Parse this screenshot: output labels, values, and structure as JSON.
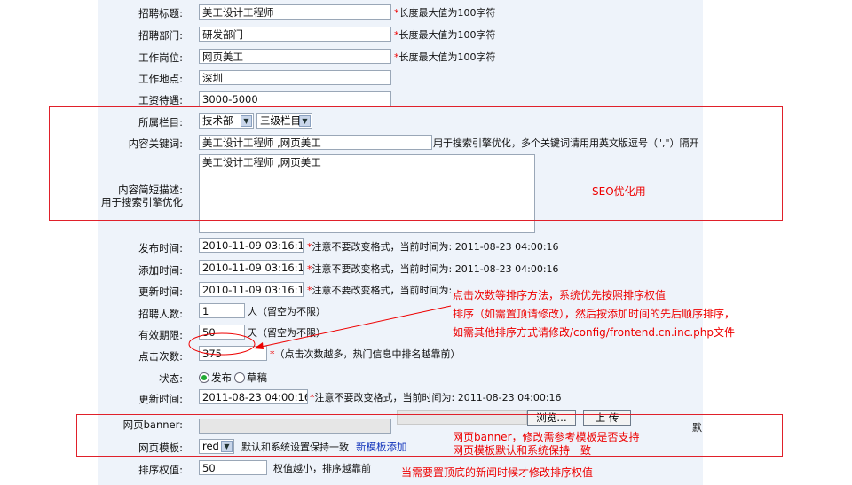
{
  "fields": {
    "title": {
      "label": "招聘标题:",
      "value": "美工设计工程师",
      "note": "长度最大值为100字符"
    },
    "dept": {
      "label": "招聘部门:",
      "value": "研发部门",
      "note": "长度最大值为100字符"
    },
    "position": {
      "label": "工作岗位:",
      "value": "网页美工",
      "note": "长度最大值为100字符"
    },
    "location": {
      "label": "工作地点:",
      "value": "深圳"
    },
    "salary": {
      "label": "工资待遇:",
      "value": "3000-5000"
    },
    "column": {
      "label": "所属栏目:",
      "select1": "技术部",
      "select2": "三级栏目"
    },
    "keywords": {
      "label": "内容关键词:",
      "value": "美工设计工程师 ,网页美工",
      "note": "用于搜索引擎优化，多个关键词请用用英文版逗号（\",\"）隔开"
    },
    "description": {
      "label1": "内容简短描述:",
      "label2": "用于搜索引擎优化",
      "value": "美工设计工程师 ,网页美工"
    },
    "publish_time": {
      "label": "发布时间:",
      "value": "2010-11-09 03:16:17",
      "note": "注意不要改变格式，当前时间为: 2011-08-23 04:00:16"
    },
    "add_time": {
      "label": "添加时间:",
      "value": "2010-11-09 03:16:17",
      "note": "注意不要改变格式，当前时间为: 2011-08-23 04:00:16"
    },
    "update_time": {
      "label": "更新时间:",
      "value": "2010-11-09 03:16:17",
      "note": "注意不要改变格式，当前时间为: 2011-08-23 04:00:16"
    },
    "headcount": {
      "label": "招聘人数:",
      "value": "1",
      "note": "人（留空为不限）"
    },
    "valid_period": {
      "label": "有效期限:",
      "value": "50",
      "note": "天（留空为不限）"
    },
    "clicks": {
      "label": "点击次数:",
      "value": "375",
      "note": "（点击次数越多，热门信息中排名越靠前）"
    },
    "status": {
      "label": "状态:",
      "opt1": "发布",
      "opt2": "草稿"
    },
    "update_time2": {
      "label": "更新时间:",
      "value": "2011-08-23 04:00:16",
      "note": "注意不要改变格式，当前时间为: 2011-08-23 04:00:16"
    },
    "banner": {
      "label": "网页banner:",
      "browse": "浏览…",
      "upload": "上 传",
      "extra": "默"
    },
    "template": {
      "label": "网页模板:",
      "value": "red",
      "note": "默认和系统设置保持一致",
      "link": "新模板添加"
    },
    "sort": {
      "label": "排序权值:",
      "value": "50",
      "note": "权值越小，排序越靠前"
    }
  },
  "annotations": {
    "seo": "SEO优化用",
    "clicks_line1": "点击次数等排序方法，系统优先按照排序权值",
    "clicks_line2": "排序（如需置顶请修改），然后按添加时间的先后顺序排序，",
    "clicks_line3": "如需其他排序方式请修改/config/frontend.cn.inc.php文件",
    "banner_line1": "网页banner，修改需参考模板是否支持",
    "banner_line2": "网页模板默认和系统保持一致",
    "sort_note": "当需要置顶底的新闻时候才修改排序权值"
  },
  "colors": {
    "annotation_red": "#e00000",
    "form_bg": "#eef3fa"
  }
}
